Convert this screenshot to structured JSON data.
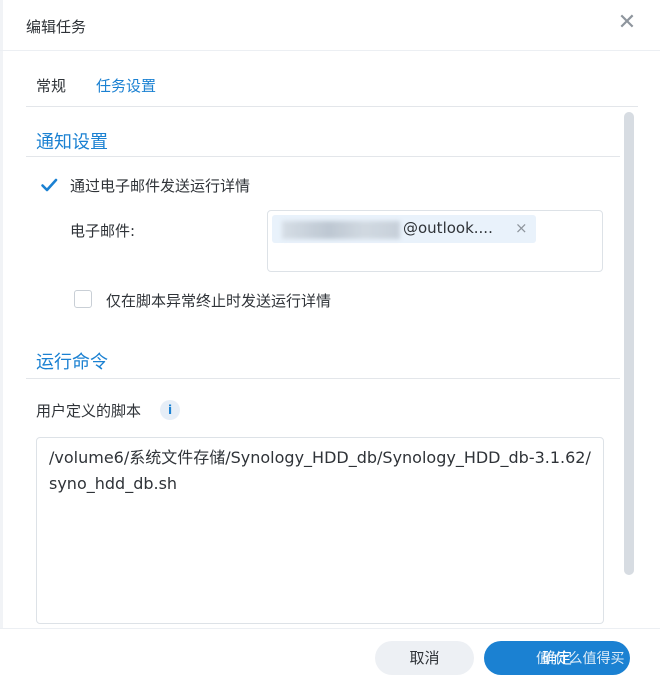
{
  "window": {
    "title": "编辑任务",
    "close_icon": "✕"
  },
  "tabs": [
    {
      "label": "常规",
      "active": false
    },
    {
      "label": "任务设置",
      "active": true
    }
  ],
  "notification": {
    "section_title": "通知设置",
    "send_email_label": "通过电子邮件发送运行详情",
    "send_email_checked": true,
    "email_label": "电子邮件:",
    "email_value": "@outlook....",
    "email_remove": "×",
    "only_on_error_label": "仅在脚本异常终止时发送运行详情",
    "only_on_error_checked": false
  },
  "run_command": {
    "section_title": "运行命令",
    "script_label": "用户定义的脚本",
    "info_icon": "i",
    "script_value": "/volume6/系统文件存储/Synology_HDD_db/Synology_HDD_db-3.1.62/syno_hdd_db.sh"
  },
  "footer": {
    "cancel_label": "取消",
    "ok_label": "确定"
  },
  "watermark": "值 什么值得买",
  "colors": {
    "accent": "#1b81d2",
    "cancel_bg": "#edf0f4"
  }
}
